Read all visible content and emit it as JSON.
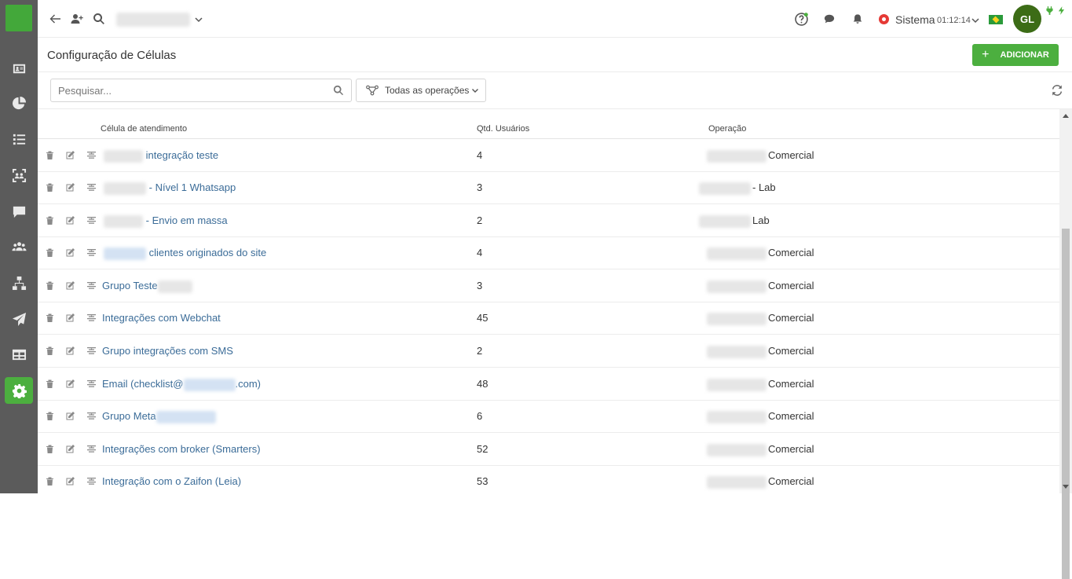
{
  "topbar": {
    "account_label": "",
    "status_label": "Sistema",
    "timer": "01:12:14",
    "avatar_initials": "GL",
    "status_color": "#e53935",
    "accent_color": "#4caf3f"
  },
  "page": {
    "title": "Configuração de Células",
    "add_button_label": "ADICIONAR"
  },
  "filters": {
    "search_placeholder": "Pesquisar...",
    "operation_select_value": "Todas as operações"
  },
  "table": {
    "headers": {
      "cell": "Célula de atendimento",
      "users": "Qtd. Usuários",
      "operation": "Operação"
    },
    "rows": [
      {
        "name": "integração teste",
        "users": "4",
        "operation": "Comercial"
      },
      {
        "name": "- Nível 1 Whatsapp",
        "users": "3",
        "operation": "- Lab"
      },
      {
        "name": "- Envio em massa",
        "users": "2",
        "operation": "Lab"
      },
      {
        "name": "clientes originados do site",
        "users": "4",
        "operation": "Comercial"
      },
      {
        "name": "Grupo Teste",
        "users": "3",
        "operation": "Comercial"
      },
      {
        "name": "Integrações com Webchat",
        "users": "45",
        "operation": "Comercial"
      },
      {
        "name": "Grupo integrações com SMS",
        "users": "2",
        "operation": "Comercial"
      },
      {
        "name": "Email (checklist@",
        "name_suffix": ".com)",
        "users": "48",
        "operation": "Comercial"
      },
      {
        "name": "Grupo Meta",
        "users": "6",
        "operation": "Comercial"
      },
      {
        "name": "Integrações com broker (Smarters)",
        "users": "52",
        "operation": "Comercial"
      },
      {
        "name": "Integração com o Zaifon (Leia)",
        "users": "53",
        "operation": "Comercial"
      }
    ]
  }
}
